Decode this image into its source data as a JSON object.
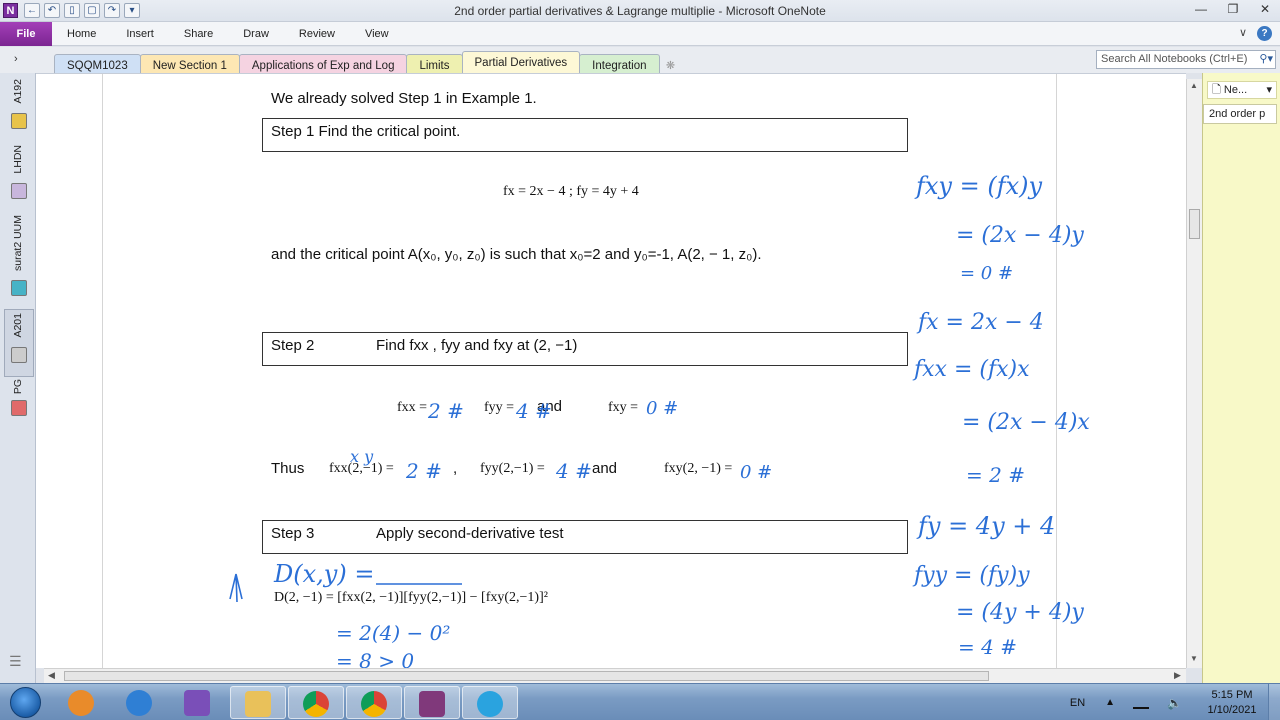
{
  "window": {
    "title": "2nd order partial derivatives & Lagrange multiplie - Microsoft OneNote",
    "app_icon_letter": "N"
  },
  "ribbon": {
    "file_label": "File",
    "tabs": [
      "Home",
      "Insert",
      "Share",
      "Draw",
      "Review",
      "View"
    ]
  },
  "sections": {
    "tabs": [
      "SQQM1023",
      "New Section 1",
      "Applications of Exp and Log",
      "Limits",
      "Partial Derivatives",
      "Integration"
    ],
    "active": "Partial Derivatives",
    "tab_colors": [
      "#cfe0f5",
      "#fde7b3",
      "#f5d3e1",
      "#eef0b0",
      "#fdf8d6",
      "#d6efd0"
    ],
    "search_placeholder": "Search All Notebooks (Ctrl+E)"
  },
  "notebooks": [
    {
      "label": "A192",
      "color": "#e8c34a"
    },
    {
      "label": "LHDN",
      "color": "#c8b6dc"
    },
    {
      "label": "surat2 UUM",
      "color": "#47b3c6"
    },
    {
      "label": "A201",
      "color": "#cccccc"
    },
    {
      "label": "PG",
      "color": "#e06a6a"
    }
  ],
  "pages_pane": {
    "new_page_label": "Ne...",
    "pages": [
      "2nd order p"
    ]
  },
  "document": {
    "intro": "We already solved Step 1 in Example 1.",
    "step1_box": "Step 1 Find the critical point.",
    "partials": "fx = 2x − 4 ;  fy = 4y + 4",
    "critical_line": "and the critical point A(x₀, y₀, z₀) is such that x₀=2 and y₀=-1, A(2, − 1, z₀).",
    "step2_label": "Step 2",
    "step2_text": "Find fxx ,  fyy and fxy at (2, −1)",
    "second_row": {
      "fxx": "fxx =",
      "fyy": "fyy =",
      "and": "and",
      "fxy": "fxy ="
    },
    "thus_row": {
      "thus": "Thus",
      "fxx": "fxx(2,−1) =",
      "comma": ",",
      "fyy": "fyy(2,−1) =",
      "and": "and",
      "fxy": "fxy(2, −1) ="
    },
    "step3_label": "Step 3",
    "step3_text": "Apply second-derivative test",
    "d_formula": "D(2, −1) = [fxx(2, −1)][fyy(2,−1)] − [fxy(2,−1)]²"
  },
  "handwriting": {
    "d_xy": "D(x,y) =",
    "fxy_eq1": "fxy = (fx)y",
    "fxy_eq2": "= (2x − 4)y",
    "fxy_eq3": "= 0 #",
    "fx_eq": "fx = 2x − 4",
    "fxx_eq1": "fxx = (fx)x",
    "fxx_eq2": "= (2x − 4)x",
    "fxx_eq3": "= 2 #",
    "fy_eq": "fy = 4y + 4",
    "fyy_eq1": "fyy = (fy)y",
    "fyy_eq2": "= (4y + 4)y",
    "fyy_eq3": "= 4 #",
    "val2": "2 #",
    "val4": "4 #",
    "val0": "0 #",
    "thus2": "2 #",
    "thus4": "4 #",
    "thus0": "0 #",
    "xy_note": "x  y",
    "calc1": "= 2(4) − 0²",
    "calc2": "= 8  > 0",
    "ink_color": "#2b6fd6"
  },
  "taskbar": {
    "apps": [
      "explorer-folder",
      "internet-explorer",
      "visual-studio",
      "file-explorer",
      "chrome",
      "chrome-profile",
      "onenote",
      "telegram"
    ],
    "language": "EN",
    "time": "5:15 PM",
    "date": "1/10/2021"
  }
}
